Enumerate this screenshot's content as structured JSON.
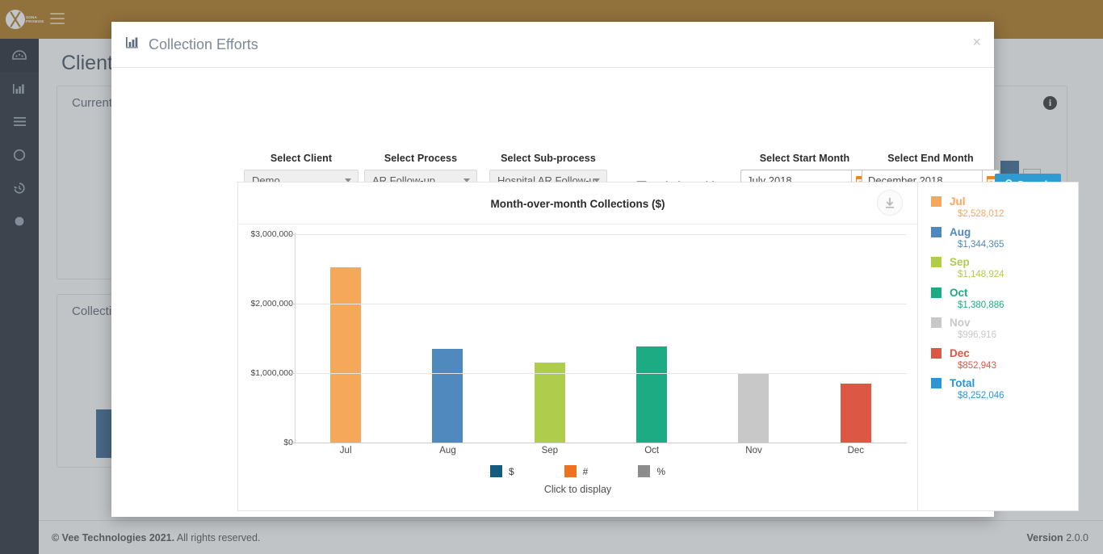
{
  "sidebar": {
    "logo_line1": "SONA",
    "logo_line2": "PROMISE",
    "items": [
      {
        "name": "dashboard",
        "icon": "dashboard-icon"
      },
      {
        "name": "reports",
        "icon": "bar-chart-icon"
      },
      {
        "name": "list",
        "icon": "list-icon"
      },
      {
        "name": "circle",
        "icon": "circle-icon"
      },
      {
        "name": "history",
        "icon": "history-icon"
      },
      {
        "name": "dot",
        "icon": "dot-icon"
      }
    ]
  },
  "background": {
    "page_title": "Client",
    "card_a_title": "Current A",
    "card_b_title": "Collection",
    "info_icon": "info-icon"
  },
  "modal": {
    "icon": "bar-chart-icon",
    "title": "Collection Efforts",
    "close_label": "×"
  },
  "filters": {
    "client": {
      "label": "Select Client",
      "value": "Demo"
    },
    "process": {
      "label": "Select Process",
      "value": "AR Follow-up"
    },
    "subprocess": {
      "label": "Select Sub-process",
      "value": "Hospital AR Follow-u"
    },
    "include_archive": {
      "label": "Include Archive",
      "checked": false
    },
    "start_month": {
      "label": "Select Start Month",
      "value": "July 2018",
      "calendar_icon": "calendar-icon"
    },
    "end_month": {
      "label": "Select End Month",
      "value": "December 2018",
      "calendar_icon": "calendar-icon"
    },
    "search": {
      "label": "Search",
      "icon": "search-icon"
    }
  },
  "chart_panel": {
    "download_icon": "download-icon",
    "footer_note": "Click to display",
    "footer_legend": [
      {
        "label": "$",
        "color": "#155a7f"
      },
      {
        "label": "#",
        "color": "#f0701f"
      },
      {
        "label": "%",
        "color": "#8c8c8c"
      }
    ]
  },
  "legend": {
    "items": [
      {
        "label": "Jul",
        "value": "$2,528,012",
        "color": "#f5a85a"
      },
      {
        "label": "Aug",
        "value": "$1,344,365",
        "color": "#5089be"
      },
      {
        "label": "Sep",
        "value": "$1,148,924",
        "color": "#afcc4c"
      },
      {
        "label": "Oct",
        "value": "$1,380,886",
        "color": "#1cab83"
      },
      {
        "label": "Nov",
        "value": "$996,916",
        "color": "#c8c8c8"
      },
      {
        "label": "Dec",
        "value": "$852,943",
        "color": "#dd5745"
      },
      {
        "label": "Total",
        "value": "$8,252,046",
        "color": "#2e94d2"
      }
    ]
  },
  "footer": {
    "copyright_bold": "© Vee Technologies 2021.",
    "copyright_rest": " All rights reserved.",
    "version_label": "Version",
    "version_value": "2.0.0"
  },
  "chart_data": {
    "type": "bar",
    "title": "Month-over-month Collections ($)",
    "xlabel": "",
    "ylabel": "",
    "categories": [
      "Jul",
      "Aug",
      "Sep",
      "Oct",
      "Nov",
      "Dec"
    ],
    "values": [
      2528012,
      1344365,
      1148924,
      1380886,
      996916,
      852943
    ],
    "colors": [
      "#f5a85a",
      "#5089be",
      "#afcc4c",
      "#1cab83",
      "#c8c8c8",
      "#dd5745"
    ],
    "ylim": [
      0,
      3000000
    ],
    "yticks": [
      0,
      1000000,
      2000000,
      3000000
    ],
    "ytick_labels": [
      "$0",
      "$1,000,000",
      "$2,000,000",
      "$3,000,000"
    ],
    "grid": true,
    "legend_position": "right",
    "total": 8252046
  }
}
